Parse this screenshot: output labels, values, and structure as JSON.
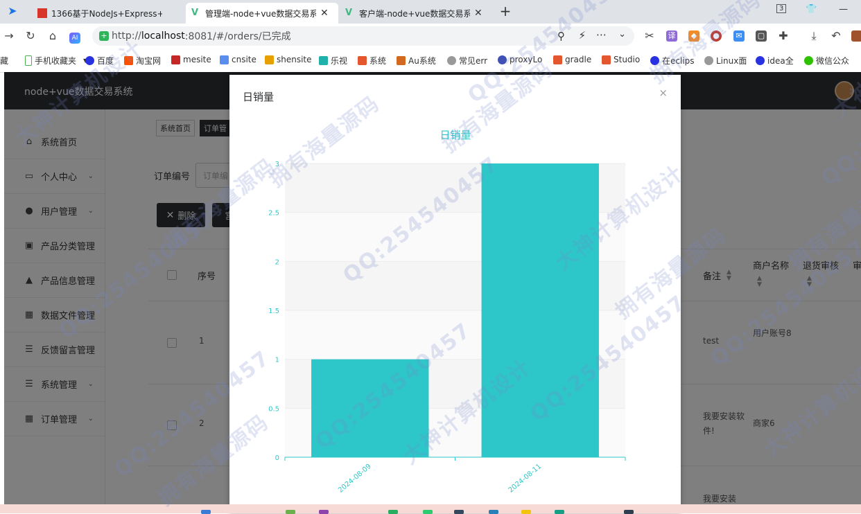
{
  "browser": {
    "tabs": [
      {
        "label": "1366基于NodeJs+Express+",
        "active": false
      },
      {
        "label": "管理端-node+vue数据交易系",
        "active": true
      },
      {
        "label": "客户端-node+vue数据交易系",
        "active": false
      }
    ],
    "url_prefix": "http://",
    "url_host": "localhost",
    "url_rest": ":8081/#/orders/已完成",
    "badge": "3",
    "bookmarks": [
      "藏",
      "手机收藏夹",
      "百度",
      "淘宝网",
      "mesite",
      "cnsite",
      "shensite",
      "乐视",
      "系统",
      "Au系统",
      "常见err",
      "proxyLo",
      "gradle",
      "Studio",
      "在eclips",
      "Linux面",
      "idea全",
      "微信公众"
    ]
  },
  "app": {
    "title": "node+vue数据交易系统",
    "sidebar": [
      {
        "label": "系统首页",
        "icon": "home-icon",
        "expandable": false
      },
      {
        "label": "个人中心",
        "icon": "card-icon",
        "expandable": true
      },
      {
        "label": "用户管理",
        "icon": "user-icon",
        "expandable": true
      },
      {
        "label": "产品分类管理",
        "icon": "category-icon",
        "expandable": false
      },
      {
        "label": "产品信息管理",
        "icon": "person-icon",
        "expandable": false
      },
      {
        "label": "数据文件管理",
        "icon": "grid-icon",
        "expandable": false
      },
      {
        "label": "反馈留言管理",
        "icon": "list-icon",
        "expandable": false
      },
      {
        "label": "系统管理",
        "icon": "list-icon",
        "expandable": true
      },
      {
        "label": "订单管理",
        "icon": "grid-icon",
        "expandable": true
      }
    ],
    "breadcrumbs": [
      "系统首页",
      "订单管"
    ],
    "search_label": "订单编号",
    "search_placeholder": "订单编",
    "delete_button": "删除",
    "second_button": "宫",
    "columns": [
      "序号",
      "备注",
      "商户名称",
      "退货审核",
      "审"
    ],
    "rows": [
      {
        "index": "1",
        "remark": "test",
        "merchant": "用户账号8"
      },
      {
        "index": "2",
        "remark": "我要安装软件!",
        "merchant": "商家6"
      },
      {
        "index": "",
        "remark": "我要安装",
        "merchant": ""
      }
    ]
  },
  "modal": {
    "title": "日销量",
    "close": "×"
  },
  "chart_data": {
    "type": "bar",
    "title": "日销量",
    "categories": [
      "2024-08-09",
      "2024-08-11"
    ],
    "values": [
      1,
      3
    ],
    "ylim": [
      0,
      3
    ],
    "yticks": [
      "0",
      "0.5",
      "1",
      "1.5",
      "2",
      "2.5",
      "3"
    ],
    "bar_color": "#2ec7c9",
    "title_color": "#2ec7c9",
    "grid": true,
    "xlabel": "",
    "ylabel": ""
  },
  "watermarks": [
    "QQ:254540457",
    "大神计算机设计",
    "拥有海量源码"
  ]
}
